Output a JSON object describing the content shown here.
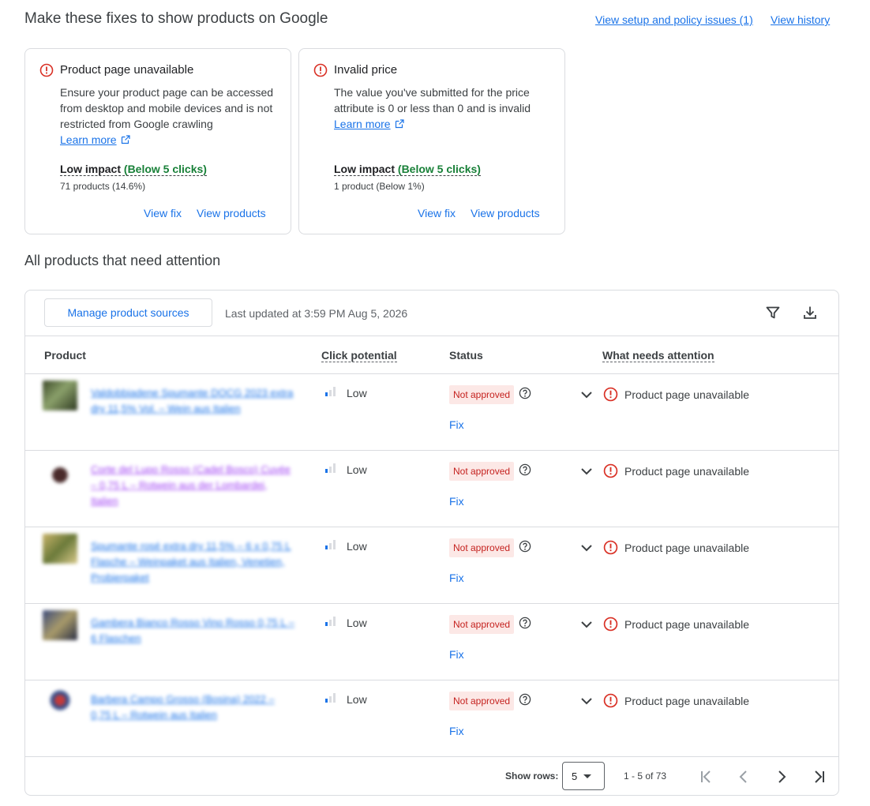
{
  "header": {
    "title": "Make these fixes to show products on Google",
    "setup_link": "View setup and policy issues (1)",
    "history_link": "View history"
  },
  "issue_cards": [
    {
      "icon": "error-icon",
      "title": "Product page unavailable",
      "description": "Ensure your product page can be accessed from desktop and mobile devices and is not restricted from Google crawling",
      "learn_more": "Learn more",
      "impact_label": "Low impact",
      "impact_detail": "(Below 5 clicks)",
      "products": "71 products (14.6%)",
      "view_fix": "View fix",
      "view_products": "View products"
    },
    {
      "icon": "error-icon",
      "title": "Invalid price",
      "description": "The value you've submitted for the price attribute is 0 or less than 0 and is invalid",
      "learn_more": "Learn more",
      "impact_label": "Low impact",
      "impact_detail": "(Below 5 clicks)",
      "products": "1 product (Below 1%)",
      "view_fix": "View fix",
      "view_products": "View products"
    }
  ],
  "section_title": "All products that need attention",
  "toolbar": {
    "manage_button": "Manage product sources",
    "last_updated": "Last updated at 3:59 PM Aug 5, 2026",
    "filter_icon": "filter-icon",
    "download_icon": "download-icon"
  },
  "table": {
    "columns": [
      "Product",
      "Click potential",
      "Status",
      "What needs attention"
    ],
    "rows": [
      {
        "product": "Valdobbiadene Spumante DOCG 2023 extra dry 11,5% Vol. – Wein aus Italien",
        "click_potential": "Low",
        "status": "Not approved",
        "fix": "Fix",
        "attention": "Product page unavailable"
      },
      {
        "product": "Corte del Lupo Rosso (Cadel Bosco) Cuvée – 0,75 L – Rotwein aus der Lombardei, Italien",
        "click_potential": "Low",
        "status": "Not approved",
        "fix": "Fix",
        "attention": "Product page unavailable"
      },
      {
        "product": "Spumante rosé extra dry 11,5% – 6 x 0,75 L Flasche – Weinpaket aus Italien, Venetien, Probierpaket",
        "click_potential": "Low",
        "status": "Not approved",
        "fix": "Fix",
        "attention": "Product page unavailable"
      },
      {
        "product": "Gambera Bianco Rosso Vino Rosso 0,75 L – 6 Flaschen",
        "click_potential": "Low",
        "status": "Not approved",
        "fix": "Fix",
        "attention": "Product page unavailable"
      },
      {
        "product": "Barbera Campo Grosso (Bosina) 2022 – 0,75 L – Rotwein aus Italien",
        "click_potential": "Low",
        "status": "Not approved",
        "fix": "Fix",
        "attention": "Product page unavailable"
      }
    ]
  },
  "pagination": {
    "show_rows_label": "Show rows:",
    "rows_value": "5",
    "range": "1 - 5 of 73"
  },
  "colors": {
    "link": "#1a73e8",
    "error": "#d93025",
    "badge_bg": "#fce8e6",
    "badge_text": "#c5221f",
    "impact_green": "#188038"
  }
}
